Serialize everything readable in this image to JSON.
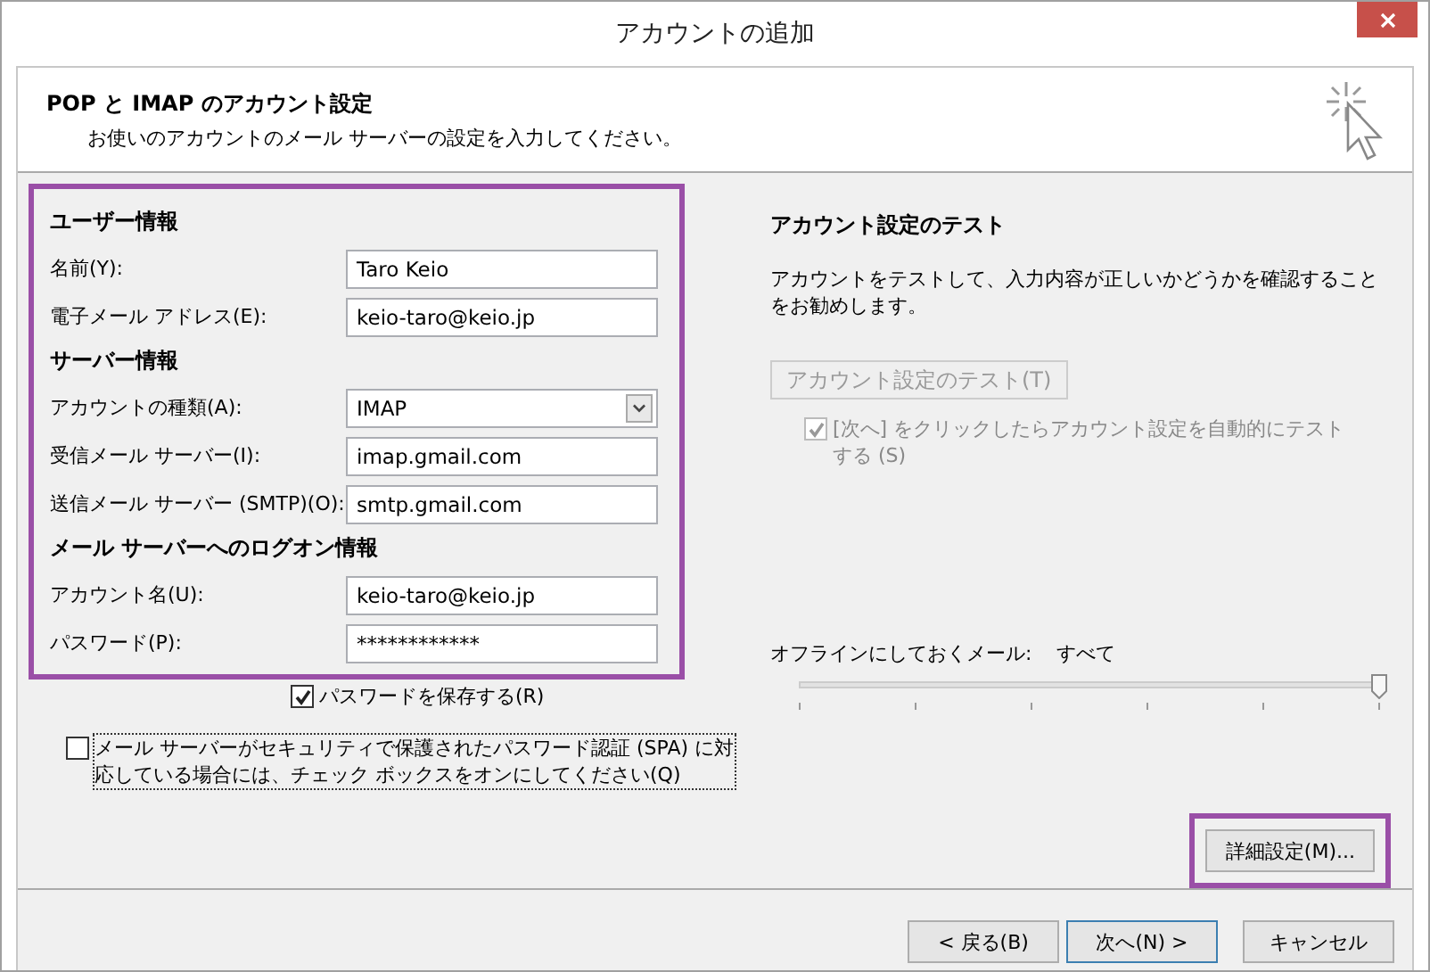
{
  "window": {
    "title": "アカウントの追加"
  },
  "header": {
    "title": "POP と IMAP のアカウント設定",
    "subtitle": "お使いのアカウントのメール サーバーの設定を入力してください。"
  },
  "sections": [
    {
      "heading": "ユーザー情報",
      "fields": [
        {
          "label": "名前(Y):",
          "value": "Taro Keio",
          "kind": "text"
        },
        {
          "label": "電子メール アドレス(E):",
          "value": "keio-taro@keio.jp",
          "kind": "text"
        }
      ]
    },
    {
      "heading": "サーバー情報",
      "fields": [
        {
          "label": "アカウントの種類(A):",
          "value": "IMAP",
          "kind": "select"
        },
        {
          "label": "受信メール サーバー(I):",
          "value": "imap.gmail.com",
          "kind": "text"
        },
        {
          "label": "送信メール サーバー (SMTP)(O):",
          "value": "smtp.gmail.com",
          "kind": "text"
        }
      ]
    },
    {
      "heading": "メール サーバーへのログオン情報",
      "fields": [
        {
          "label": "アカウント名(U):",
          "value": "keio-taro@keio.jp",
          "kind": "text"
        },
        {
          "label": "パスワード(P):",
          "value": "************",
          "kind": "text"
        }
      ]
    }
  ],
  "save_password": {
    "label": "パスワードを保存する(R)",
    "checked": true
  },
  "spa": {
    "label": "メール サーバーがセキュリティで保護されたパスワード認証 (SPA) に対応している場合には、チェック ボックスをオンにしてください(Q)",
    "checked": false
  },
  "test": {
    "heading": "アカウント設定のテスト",
    "description": "アカウントをテストして、入力内容が正しいかどうかを確認することをお勧めします。",
    "button": {
      "label": "アカウント設定のテスト(T)",
      "disabled": true
    },
    "auto_test": {
      "label": "[次へ] をクリックしたらアカウント設定を自動的にテストする (S)",
      "checked": true,
      "disabled": true
    }
  },
  "offline": {
    "label": "オフラインにしておくメール:",
    "value": "すべて",
    "level": 1
  },
  "advanced_button": {
    "label": "詳細設定(M)..."
  },
  "buttons": [
    {
      "label": "< 戻る(B)",
      "focused": false
    },
    {
      "label": "次へ(N) >",
      "focused": true
    },
    {
      "label": "キャンセル",
      "focused": false
    }
  ]
}
